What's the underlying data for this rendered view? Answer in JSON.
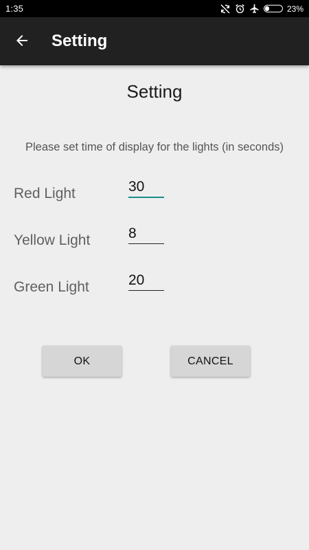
{
  "status_bar": {
    "time": "1:35",
    "battery_percent": "23%",
    "battery_level": 0.23,
    "icons": [
      "sync-disabled-icon",
      "alarm-icon",
      "airplane-icon",
      "battery-icon"
    ]
  },
  "app_bar": {
    "title": "Setting",
    "background_color": "#212121",
    "back_icon": "arrow-back-icon"
  },
  "dialog": {
    "title": "Setting",
    "instruction": "Please set time of display for the lights (in seconds)",
    "fields": [
      {
        "label": "Red Light",
        "value": "30",
        "focused": true
      },
      {
        "label": "Yellow Light",
        "value": "8",
        "focused": false
      },
      {
        "label": "Green Light",
        "value": "20",
        "focused": false
      }
    ],
    "accent_color": "#1a8c8c"
  },
  "buttons": {
    "ok_label": "OK",
    "cancel_label": "CANCEL"
  }
}
